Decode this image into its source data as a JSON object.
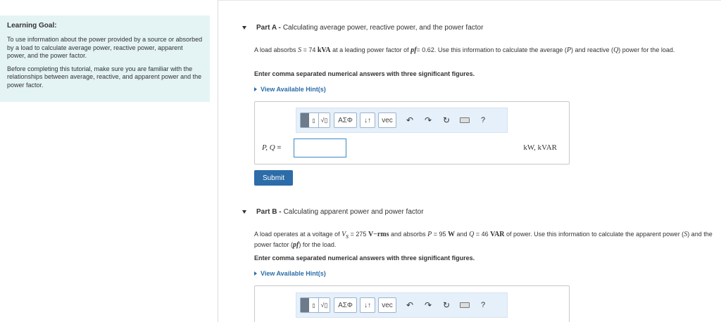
{
  "learning_goal": {
    "title": "Learning Goal:",
    "paragraph1": "To use information about the power provided by a source or absorbed by a load to calculate average power, reactive power, apparent power, and the power factor.",
    "paragraph2": "Before completing this tutorial, make sure you are familiar with the relationships between average, reactive, and apparent power and the power factor."
  },
  "part_a": {
    "label": "Part A -",
    "title": "Calculating average power, reactive power, and the power factor",
    "prompt_pre": "A load absorbs",
    "prompt_S": "S",
    "prompt_S_val": "= 74",
    "prompt_S_unit": "kVA",
    "prompt_mid": "at a leading power factor of",
    "prompt_pf": "pf",
    "prompt_pf_val": "= 0.62. Use this information to calculate the average (",
    "prompt_P": "P",
    "prompt_and": ") and reactive (",
    "prompt_Q": "Q",
    "prompt_end": ") power for the load.",
    "instruction": "Enter comma separated numerical answers with three significant figures.",
    "hint_label": "View Available Hint(s)",
    "var_label": "P, Q",
    "var_eq": "=",
    "input_value": "",
    "units": "kW, kVAR",
    "submit_label": "Submit"
  },
  "part_b": {
    "label": "Part B -",
    "title": "Calculating apparent power and power factor",
    "prompt_pre": "A load operates at a voltage of",
    "prompt_V": "V",
    "prompt_V_sub": "s",
    "prompt_V_val": "= 275",
    "prompt_V_unit": "V−rms",
    "prompt_mid": "and absorbs",
    "prompt_P": "P",
    "prompt_P_val": "= 95",
    "prompt_P_unit": "W",
    "prompt_and": "and",
    "prompt_Q": "Q",
    "prompt_Q_val": "= 46",
    "prompt_Q_unit": "VAR",
    "prompt_end": "of power. Use this information to calculate the apparent power (",
    "prompt_S": "S",
    "prompt_end2": ") and the power factor (",
    "prompt_pf": "pf",
    "prompt_end3": ") for the load.",
    "instruction": "Enter comma separated numerical answers with three significant figures.",
    "hint_label": "View Available Hint(s)"
  },
  "toolbar": {
    "greek_label": "ΑΣΦ",
    "sort_label": "↓↑",
    "vec_label": "vec",
    "help_label": "?",
    "icons": [
      "templates-icon",
      "greek-symbols-icon",
      "sort-icon",
      "vector-icon",
      "undo-icon",
      "redo-icon",
      "reset-icon",
      "keyboard-icon",
      "help-icon"
    ]
  }
}
